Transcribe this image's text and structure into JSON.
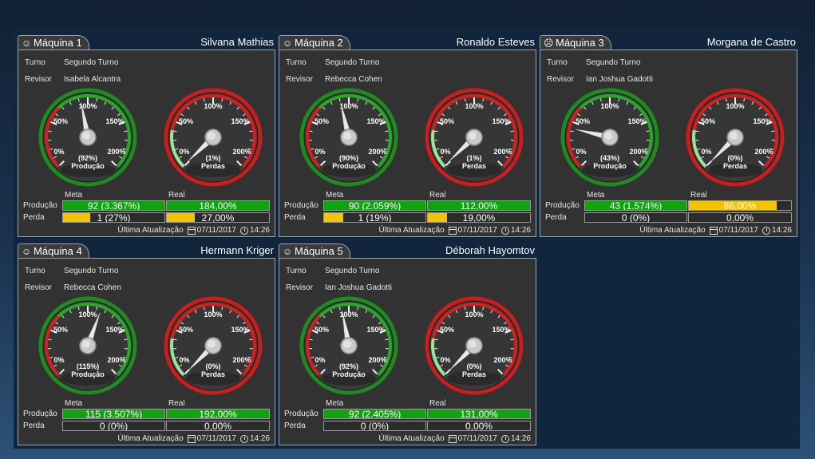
{
  "labels": {
    "shift": "Turno",
    "reviewer": "Revisor",
    "production": "Produção",
    "loss": "Perda",
    "target": "Meta",
    "actual": "Real",
    "last_update": "Última Atualização",
    "gauge_production": "Produção",
    "gauge_losses": "Perdas"
  },
  "gauge_ticks": [
    "0%",
    "50%",
    "100%",
    "150%",
    "200%"
  ],
  "colors": {
    "green_bar": "#0fa30f",
    "yellow_bar": "#f5c400",
    "green_ring": "#1f8a1f",
    "red_ring": "#c81e1e"
  },
  "machines": [
    {
      "title": "Máquina 1",
      "status_icon": "happy-face-icon",
      "operator": "Silvana Mathias",
      "shift": "Segundo Turno",
      "reviewer": "Isabela Alcantra",
      "production_gauge": {
        "percent_text": "(92%)",
        "value": 92
      },
      "loss_gauge": {
        "percent_text": "(1%)",
        "value": 1
      },
      "production_target": {
        "text": "92 (3.367%)",
        "fill": 1.0,
        "color": "green"
      },
      "production_actual": {
        "text": "184,00%",
        "fill": 1.0,
        "color": "green"
      },
      "loss_target": {
        "text": "1 (27%)",
        "fill": 0.27,
        "color": "yellow"
      },
      "loss_actual": {
        "text": "27,00%",
        "fill": 0.27,
        "color": "yellow"
      },
      "date": "07/11/2017",
      "time": "14:26"
    },
    {
      "title": "Máquina 2",
      "status_icon": "happy-face-icon",
      "operator": "Ronaldo Esteves",
      "shift": "Segundo Turno",
      "reviewer": "Rebecca Cohen",
      "production_gauge": {
        "percent_text": "(90%)",
        "value": 90
      },
      "loss_gauge": {
        "percent_text": "(1%)",
        "value": 1
      },
      "production_target": {
        "text": "90 (2.059%)",
        "fill": 1.0,
        "color": "green"
      },
      "production_actual": {
        "text": "112,00%",
        "fill": 1.0,
        "color": "green"
      },
      "loss_target": {
        "text": "1 (19%)",
        "fill": 0.19,
        "color": "yellow"
      },
      "loss_actual": {
        "text": "19,00%",
        "fill": 0.19,
        "color": "yellow"
      },
      "date": "07/11/2017",
      "time": "14:26"
    },
    {
      "title": "Máquina 3",
      "status_icon": "sad-face-icon",
      "operator": "Morgana de Castro",
      "shift": "Segundo Turno",
      "reviewer": "Ian Joshua Gadotti",
      "production_gauge": {
        "percent_text": "(43%)",
        "value": 43
      },
      "loss_gauge": {
        "percent_text": "(0%)",
        "value": 0
      },
      "production_target": {
        "text": "43 (1.574%)",
        "fill": 1.0,
        "color": "green"
      },
      "production_actual": {
        "text": "86,00%",
        "fill": 0.86,
        "color": "yellow"
      },
      "loss_target": {
        "text": "0 (0%)",
        "fill": 0,
        "color": "yellow"
      },
      "loss_actual": {
        "text": "0,00%",
        "fill": 0,
        "color": "yellow"
      },
      "date": "07/11/2017",
      "time": "14:26"
    },
    {
      "title": "Máquina 4",
      "status_icon": "happy-face-icon",
      "operator": "Hermann Kriger",
      "shift": "Segundo Turno",
      "reviewer": "Rebecca Cohen",
      "production_gauge": {
        "percent_text": "(115%)",
        "value": 115
      },
      "loss_gauge": {
        "percent_text": "(0%)",
        "value": 0
      },
      "production_target": {
        "text": "115 (3.507%)",
        "fill": 1.0,
        "color": "green"
      },
      "production_actual": {
        "text": "192,00%",
        "fill": 1.0,
        "color": "green"
      },
      "loss_target": {
        "text": "0 (0%)",
        "fill": 0,
        "color": "yellow"
      },
      "loss_actual": {
        "text": "0,00%",
        "fill": 0,
        "color": "yellow"
      },
      "date": "07/11/2017",
      "time": "14:26"
    },
    {
      "title": "Máquina 5",
      "status_icon": "happy-face-icon",
      "operator": "Déborah Hayomtov",
      "shift": "Segundo Turno",
      "reviewer": "Ian Joshua Gadotti",
      "production_gauge": {
        "percent_text": "(92%)",
        "value": 92
      },
      "loss_gauge": {
        "percent_text": "(0%)",
        "value": 0
      },
      "production_target": {
        "text": "92 (2.405%)",
        "fill": 1.0,
        "color": "green"
      },
      "production_actual": {
        "text": "131,00%",
        "fill": 1.0,
        "color": "green"
      },
      "loss_target": {
        "text": "0 (0%)",
        "fill": 0,
        "color": "yellow"
      },
      "loss_actual": {
        "text": "0,00%",
        "fill": 0,
        "color": "yellow"
      },
      "date": "07/11/2017",
      "time": "14:26"
    }
  ]
}
